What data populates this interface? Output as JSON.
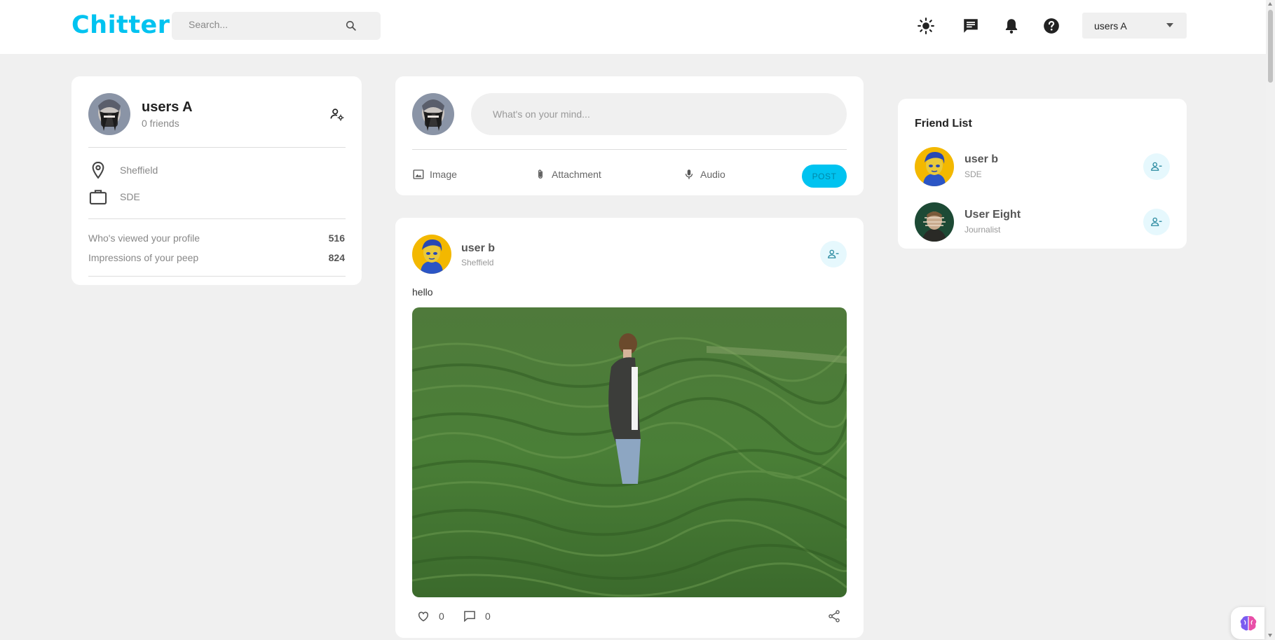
{
  "header": {
    "logo": "Chitter",
    "search_placeholder": "Search...",
    "icons": [
      "brightness-icon",
      "chat-icon",
      "bell-icon",
      "help-icon"
    ],
    "user_menu": "users A"
  },
  "profile": {
    "name": "users A",
    "friends": "0 friends",
    "location": "Sheffield",
    "job": "SDE",
    "stats": [
      {
        "label": "Who's viewed your profile",
        "value": "516"
      },
      {
        "label": "Impressions of your peep",
        "value": "824"
      }
    ]
  },
  "composer": {
    "placeholder": "What's on your mind...",
    "image_label": "Image",
    "attachment_label": "Attachment",
    "audio_label": "Audio",
    "post_label": "POST"
  },
  "post": {
    "author": "user b",
    "location": "Sheffield",
    "text": "hello",
    "likes": "0",
    "comments": "0"
  },
  "friend_list": {
    "title": "Friend List",
    "friends": [
      {
        "name": "user b",
        "job": "SDE"
      },
      {
        "name": "User Eight",
        "job": "Journalist"
      }
    ]
  },
  "colors": {
    "accent": "#00c3f0",
    "page_bg": "#f0f0f0"
  }
}
